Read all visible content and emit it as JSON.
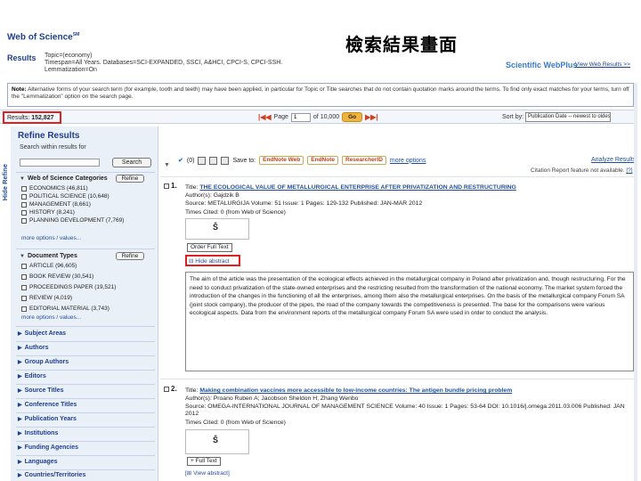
{
  "slide": {
    "title": "檢索結果畫面"
  },
  "header": {
    "logo": "Web of Science",
    "logo_sup": "SM",
    "results_label": "Results",
    "query_lines": [
      "Topic=(economy)",
      "Timespan=All Years. Databases=SCI-EXPANDED, SSCI, A&HCI, CPCI-S, CPCI-SSH.",
      "Lemmatization=On"
    ],
    "scientific_webplus": "Scientific WebPlus",
    "view_web_results": "View Web Results >>"
  },
  "note": {
    "label": "Note:",
    "text": "Alternative forms of your search term (for example, tooth and teeth) may have been applied, in particular for Topic or Title searches that do not contain quotation marks around the terms. To find only exact matches for your terms, turn off the \"Lemmatization\" option on the search page."
  },
  "results_bar": {
    "results_label": "Results:",
    "results_count": "152,827",
    "page_label": "Page",
    "page_value": "1",
    "of_label": "of 10,000",
    "go_label": "Go",
    "sort_label": "Sort by:",
    "sort_value": "Publication Date -- newest to oldest"
  },
  "hide_refine": "Hide Refine",
  "refine": {
    "title": "Refine Results",
    "search_within_label": "Search within results for",
    "search_button": "Search",
    "wos_categories": {
      "header": "Web of Science Categories",
      "refine_button": "Refine",
      "items": [
        "ECONOMICS (46,811)",
        "POLITICAL SCIENCE (10,648)",
        "MANAGEMENT (8,661)",
        "HISTORY (8,241)",
        "PLANNING DEVELOPMENT (7,769)"
      ],
      "more_options": "more options / values..."
    },
    "document_types": {
      "header": "Document Types",
      "refine_button": "Refine",
      "items": [
        "ARTICLE (96,605)",
        "BOOK REVIEW (30,541)",
        "PROCEEDINGS PAPER (19,521)",
        "REVIEW (4,019)",
        "EDITORIAL MATERIAL (3,743)"
      ],
      "more_options": "more options / values..."
    },
    "collapsed_sections": [
      "Subject Areas",
      "Authors",
      "Group Authors",
      "Editors",
      "Source Titles",
      "Conference Titles",
      "Publication Years",
      "Institutions",
      "Funding Agencies",
      "Languages",
      "Countries/Territories"
    ]
  },
  "toolbar": {
    "checked_count": "(0)",
    "save_to_label": "Save to:",
    "endnote_web": "EndNote Web",
    "endnote": "EndNote",
    "researcherid": "ResearcherID",
    "more_options": "more options",
    "analyze_results": "Analyze Results",
    "citation_report": "Citation Report feature not available.",
    "citation_report_help": "[?]"
  },
  "records": [
    {
      "num": "1.",
      "title_prefix": "Title:",
      "title": "THE ECOLOGICAL VALUE OF METALLURGICAL ENTERPRISE AFTER PRIVATIZATION AND RESTRUCTURING",
      "authors": "Author(s): Gajdzik B",
      "source": "Source: METALURGIJA  Volume: 51  Issue: 1  Pages: 129-132  Published: JAN-MAR 2012",
      "times_cited": "Times Cited: 0 (from Web of Science)",
      "order_button": "Order Full Text",
      "abstract_toggle": "Hide abstract",
      "abstract": "The aim of the article was the presentation of the ecological effects achieved in the metallurgical company in Poland after privatization and, though restructuring. For the need to conduct privatization of the state-owned enterprises and the restricting resulted from the transformation of the national economy. The market system forced the introduction of the changes in the functioning of all the enterprises, among them also the metallurgical enterprises. On the basis of the metallurgical company Forum SA (joint stock company), the producer of the pipes, the road of the company towards the competitiveness is presented. The base for the comparisons were various ecological aspects. Data from the environment reports of the metallurgical company Forum SA were used in order to conduct the analysis."
    },
    {
      "num": "2.",
      "title_prefix": "Title:",
      "title": "Making combination vaccines more accessible to low-income countries: The antigen bundle pricing problem",
      "authors": "Author(s): Proano Ruben A; Jacobson Sheldon H; Zhang Wenbo",
      "source": "Source: OMEGA-INTERNATIONAL JOURNAL OF MANAGEMENT SCIENCE  Volume: 40  Issue: 1  Pages: 53-64  DOI: 10.1016/j.omega.2011.03.006  Published: JAN",
      "source_cont": "2012",
      "times_cited": "Times Cited: 0 (from Web of Science)",
      "order_button": "Full Text",
      "abstract_toggle": "View abstract"
    }
  ]
}
